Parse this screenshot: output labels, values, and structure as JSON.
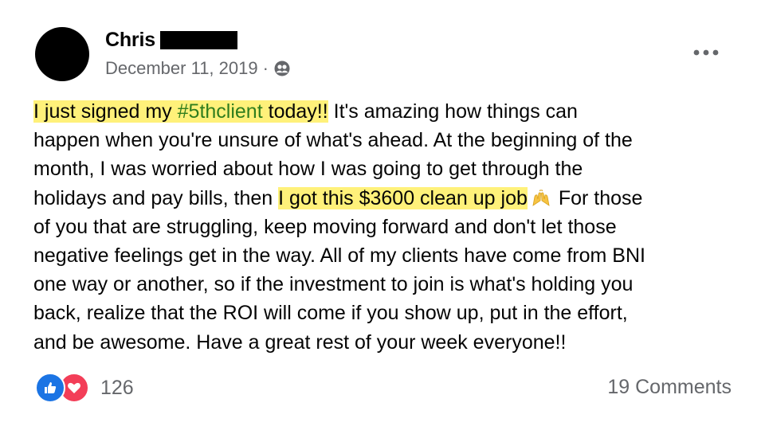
{
  "post": {
    "author": {
      "name": "Chris"
    },
    "date": "December 11, 2019",
    "separator": "·",
    "audience_icon": "friends-icon",
    "more_label": "•••",
    "text": {
      "line1": {
        "hl_a": "I just signed my ",
        "hashtag": "#5thclient",
        "hl_b": " today!!",
        "rest": " It's amazing how things can"
      },
      "line2": "happen when you're unsure of what's ahead. At the beginning of the",
      "line3": "month, I was worried about how I was going to get through the",
      "line4": {
        "pre": "holidays and pay bills, then ",
        "hl": "I got this $3600 clean up job",
        "emoji": "raising-hands-emoji",
        "post": " For those"
      },
      "line5": "of you that are struggling, keep moving forward and don't let those",
      "line6": "negative feelings get in the way. All of my clients have come from BNI",
      "line7": "one way or another, so if the investment to join is what's holding you",
      "line8": "back, realize that the ROI will come if you show up, put in the effort,",
      "line9": "and be awesome. Have a great rest of your week everyone!!"
    },
    "reactions": {
      "icons": [
        "like-icon",
        "love-icon"
      ],
      "count": "126"
    },
    "comments_label": "19 Comments"
  },
  "colors": {
    "highlight": "#fff17a",
    "hashtag": "#2f7d1d",
    "muted": "#65676b",
    "like": "#1b74e4",
    "love": "#f33e58"
  }
}
